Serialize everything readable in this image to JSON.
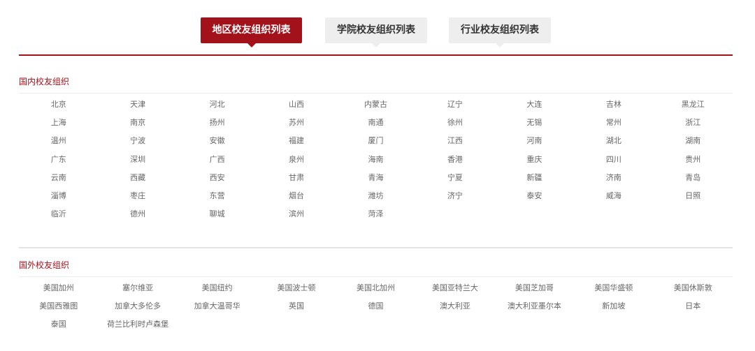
{
  "tabs": [
    {
      "label": "地区校友组织列表",
      "active": true
    },
    {
      "label": "学院校友组织列表",
      "active": false
    },
    {
      "label": "行业校友组织列表",
      "active": false
    }
  ],
  "domestic": {
    "title": "国内校友组织",
    "items": [
      "北京",
      "天津",
      "河北",
      "山西",
      "内蒙古",
      "辽宁",
      "大连",
      "吉林",
      "黑龙江",
      "上海",
      "南京",
      "扬州",
      "苏州",
      "南通",
      "徐州",
      "无锡",
      "常州",
      "浙江",
      "温州",
      "宁波",
      "安徽",
      "福建",
      "厦门",
      "江西",
      "河南",
      "湖北",
      "湖南",
      "广东",
      "深圳",
      "广西",
      "泉州",
      "海南",
      "香港",
      "重庆",
      "四川",
      "贵州",
      "云南",
      "西藏",
      "西安",
      "甘肃",
      "青海",
      "宁夏",
      "新疆",
      "济南",
      "青岛",
      "淄博",
      "枣庄",
      "东营",
      "烟台",
      "潍坊",
      "济宁",
      "泰安",
      "威海",
      "日照",
      "临沂",
      "德州",
      "聊城",
      "滨州",
      "菏泽"
    ]
  },
  "overseas": {
    "title": "国外校友组织",
    "items": [
      "美国加州",
      "塞尔维亚",
      "美国纽约",
      "美国波士顿",
      "美国北加州",
      "美国亚特兰大",
      "美国芝加哥",
      "美国华盛顿",
      "美国休斯敦",
      "美国西雅图",
      "加拿大多伦多",
      "加拿大温哥华",
      "英国",
      "德国",
      "澳大利亚",
      "澳大利亚墨尔本",
      "新加坡",
      "日本",
      "泰国",
      "荷兰比利时卢森堡"
    ]
  },
  "colors": {
    "accent": "#a3111b",
    "tab_inactive_bg": "#eeeeee"
  }
}
